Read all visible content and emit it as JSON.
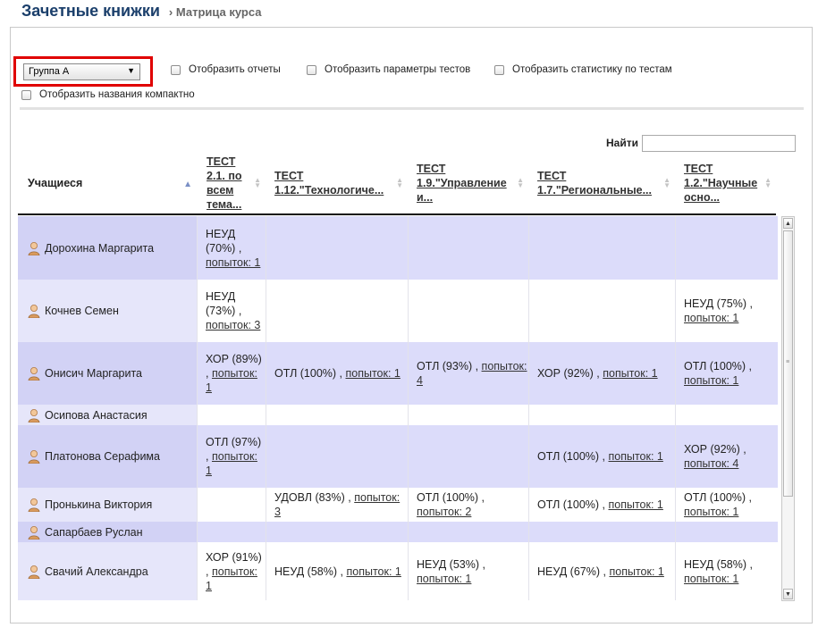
{
  "header": {
    "title": "Зачетные книжки",
    "breadcrumb": "› Матрица курса"
  },
  "filters": {
    "group": "Группа А",
    "options": [
      "Отобразить отчеты",
      "Отобразить параметры тестов",
      "Отобразить статистику по тестам",
      "Отобразить названия компактно"
    ]
  },
  "search": {
    "label": "Найти",
    "value": ""
  },
  "columns": [
    {
      "label": "Учащиеся"
    },
    {
      "label": "ТЕСТ 2.1. по всем тема..."
    },
    {
      "label": "ТЕСТ 1.12.\"Технологиче..."
    },
    {
      "label": "ТЕСТ 1.9.\"Управление и..."
    },
    {
      "label": "ТЕСТ 1.7.\"Региональные..."
    },
    {
      "label": "ТЕСТ 1.2.\"Научные осно..."
    }
  ],
  "rows": [
    {
      "name": "Дорохина Маргарита",
      "cells": [
        {
          "grade": "НЕУД (70%) ,",
          "attempts": "попыток: 1"
        },
        null,
        null,
        null,
        null
      ]
    },
    {
      "name": "Кочнев Семен",
      "cells": [
        {
          "grade": "НЕУД (73%) ,",
          "attempts": "попыток: 3"
        },
        null,
        null,
        null,
        {
          "grade": "НЕУД (75%) ,",
          "attempts": "попыток: 1"
        }
      ]
    },
    {
      "name": "Онисич Маргарита",
      "cells": [
        {
          "grade": "ХОР (89%) ,",
          "attempts": "попыток: 1"
        },
        {
          "grade": "ОТЛ (100%) ,",
          "attempts": "попыток: 1"
        },
        {
          "grade": "ОТЛ (93%) ,",
          "attempts": "попыток: 4"
        },
        {
          "grade": "ХОР (92%) ,",
          "attempts": "попыток: 1"
        },
        {
          "grade": "ОТЛ (100%) ,",
          "attempts": "попыток: 1"
        }
      ]
    },
    {
      "name": "Осипова Анастасия",
      "cells": [
        null,
        null,
        null,
        null,
        null
      ]
    },
    {
      "name": "Платонова Серафима",
      "cells": [
        {
          "grade": "ОТЛ (97%) ,",
          "attempts": "попыток: 1"
        },
        null,
        null,
        {
          "grade": "ОТЛ (100%) ,",
          "attempts": "попыток: 1"
        },
        {
          "grade": "ХОР (92%) ,",
          "attempts": "попыток: 4"
        }
      ]
    },
    {
      "name": "Пронькина Виктория",
      "cells": [
        null,
        {
          "grade": "УДОВЛ (83%) ,",
          "attempts": "попыток: 3"
        },
        {
          "grade": "ОТЛ (100%) ,",
          "attempts": "попыток: 2"
        },
        {
          "grade": "ОТЛ (100%) ,",
          "attempts": "попыток: 1"
        },
        {
          "grade": "ОТЛ (100%) ,",
          "attempts": "попыток: 1"
        }
      ]
    },
    {
      "name": "Сапарбаев Руслан",
      "cells": [
        null,
        null,
        null,
        null,
        null
      ]
    },
    {
      "name": "Свачий Александра",
      "cells": [
        {
          "grade": "ХОР (91%) ,",
          "attempts": "попыток: 1"
        },
        {
          "grade": "НЕУД (58%) ,",
          "attempts": "попыток: 1"
        },
        {
          "grade": "НЕУД (53%) ,",
          "attempts": "попыток: 1"
        },
        {
          "grade": "НЕУД (67%) ,",
          "attempts": "попыток: 1"
        },
        {
          "grade": "НЕУД (58%) ,",
          "attempts": "попыток: 1"
        }
      ]
    }
  ]
}
